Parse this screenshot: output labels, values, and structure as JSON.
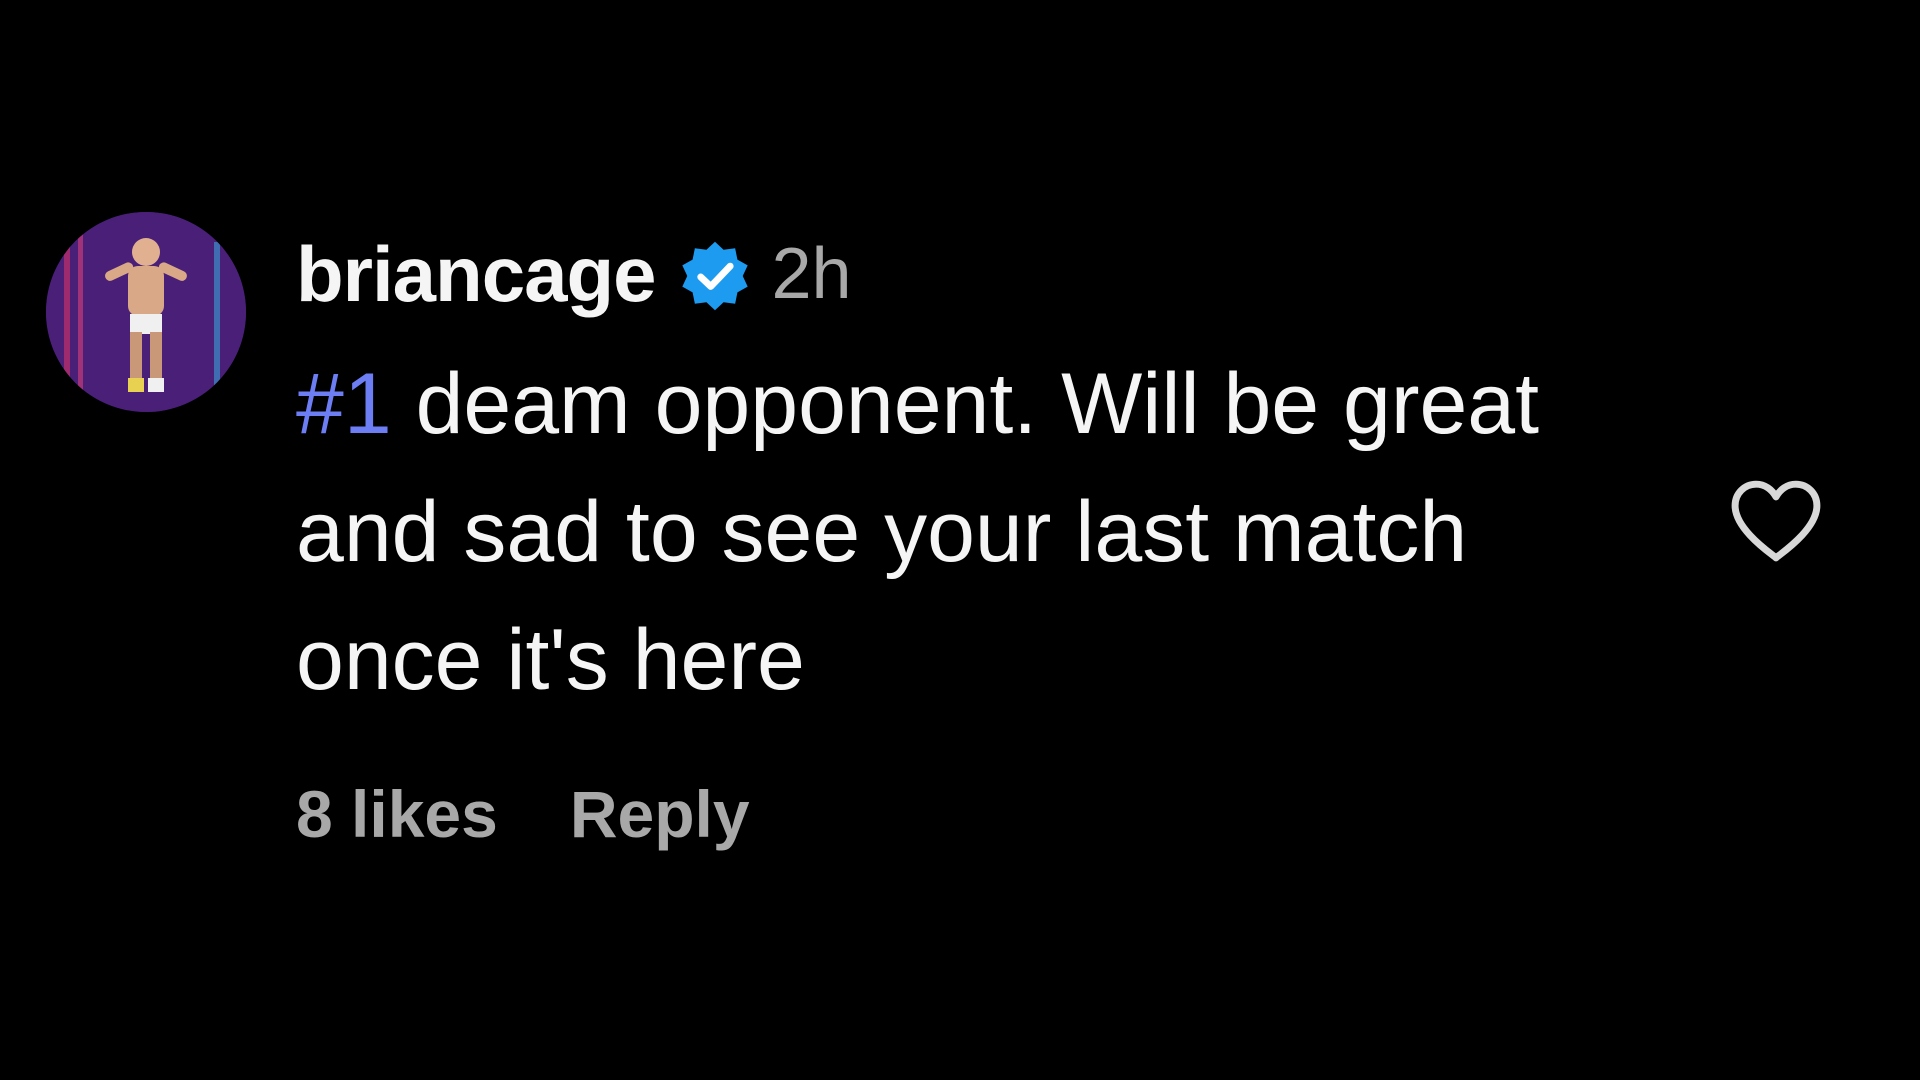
{
  "comment": {
    "username": "briancage",
    "verified": true,
    "time": "2h",
    "hashtag": "#1",
    "text": " deam opponent. Will be great and sad to see your last match once it's here",
    "likes_label": "8 likes",
    "reply_label": "Reply",
    "icons": {
      "avatar": "profile-photo",
      "verified": "verified-badge-icon",
      "like": "heart-outline-icon"
    },
    "colors": {
      "background": "#000000",
      "text": "#f5f5f5",
      "secondary": "#a8a8a8",
      "hashtag": "#6d7ef5",
      "verified": "#1d9bf0"
    }
  }
}
